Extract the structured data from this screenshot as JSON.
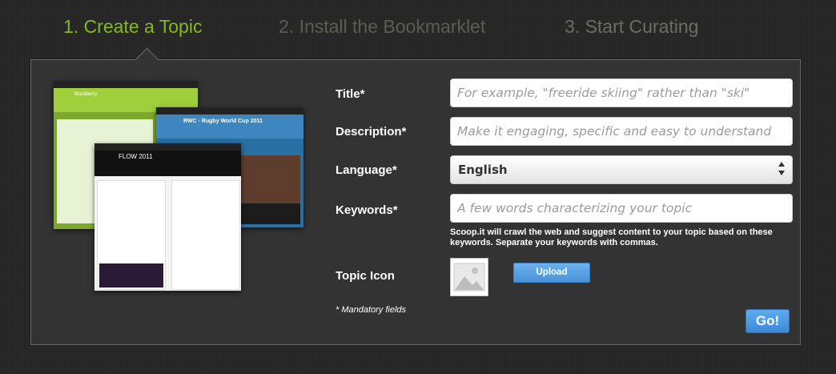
{
  "steps": [
    {
      "label": "1. Create a Topic"
    },
    {
      "label": "2. Install the Bookmarklet"
    },
    {
      "label": "3. Start Curating"
    }
  ],
  "colors": {
    "active_step": "#86b81c",
    "inactive_step": "#5a5e52",
    "button_blue": "#4a91d9"
  },
  "preview": {
    "shot_a_title": "Blackberry",
    "shot_b_title": "RWC - Rugby World Cup 2011",
    "shot_c_title": "FLOW 2011"
  },
  "form": {
    "title": {
      "label": "Title*",
      "placeholder": "For example, \"freeride skiing\" rather than \"ski\"",
      "value": ""
    },
    "description": {
      "label": "Description*",
      "placeholder": "Make it engaging, specific and easy to understand",
      "value": ""
    },
    "language": {
      "label": "Language*",
      "selected": "English"
    },
    "keywords": {
      "label": "Keywords*",
      "placeholder": "A few words characterizing your topic",
      "value": "",
      "hint": "Scoop.it will crawl the web and suggest content to your topic based on these keywords. Separate your keywords with commas."
    },
    "topic_icon": {
      "label": "Topic Icon",
      "upload_label": "Upload",
      "placeholder_icon": "image-placeholder-icon"
    },
    "mandatory_note": "* Mandatory fields",
    "submit_label": "Go!"
  }
}
